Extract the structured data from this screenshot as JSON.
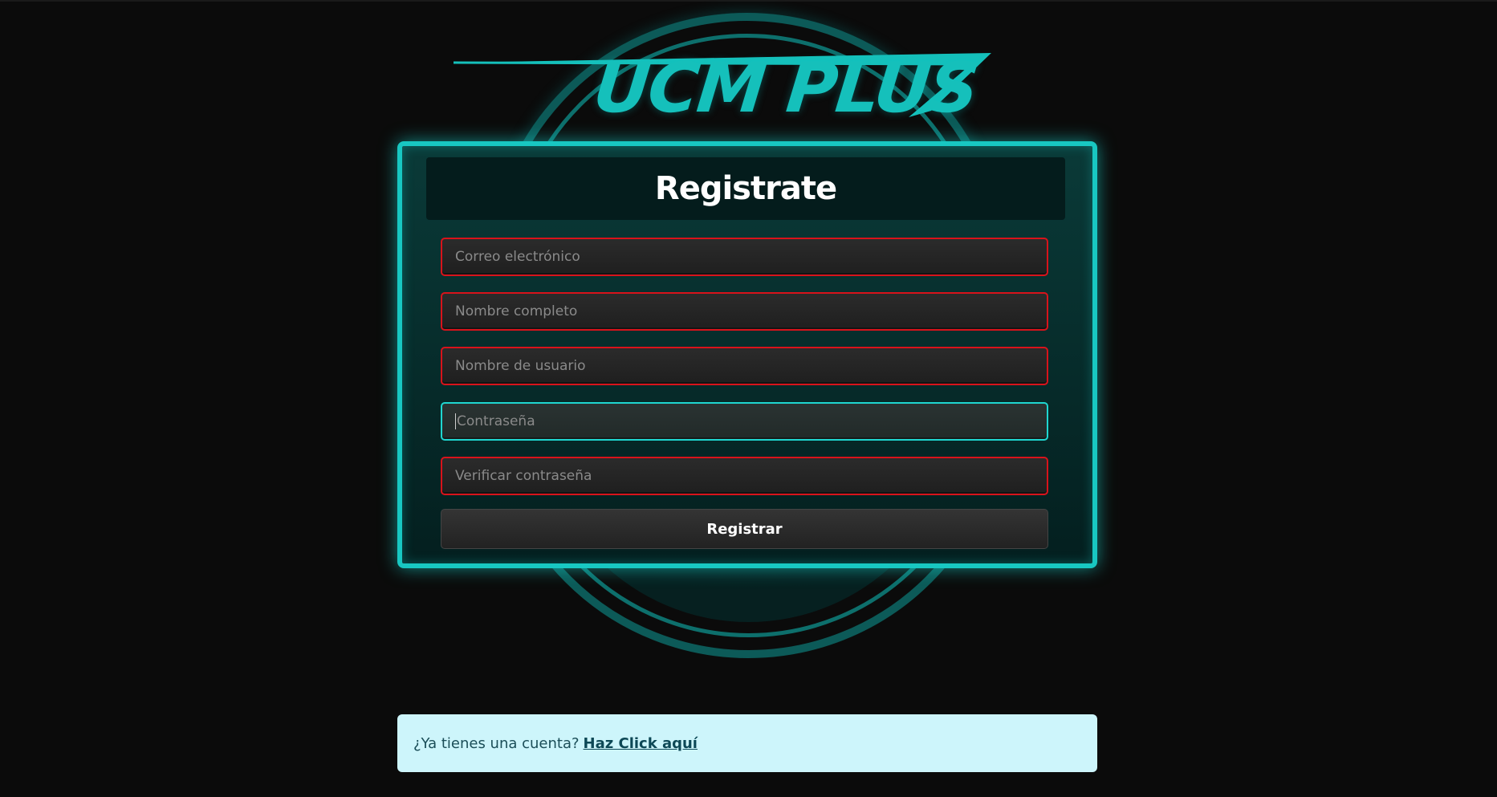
{
  "logo": {
    "text": "UCM PLUS"
  },
  "form": {
    "title": "Registrate",
    "fields": [
      {
        "placeholder": "Correo electrónico",
        "state": "invalid"
      },
      {
        "placeholder": "Nombre completo",
        "state": "invalid"
      },
      {
        "placeholder": "Nombre de usuario",
        "state": "invalid"
      },
      {
        "placeholder": "Contraseña",
        "state": "focused"
      },
      {
        "placeholder": "Verificar contraseña",
        "state": "invalid"
      }
    ],
    "submit_label": "Registrar"
  },
  "login_prompt": {
    "text": "¿Ya tienes una cuenta?",
    "link_label": "Haz Click aquí"
  },
  "colors": {
    "accent": "#18c7c2",
    "invalid_border": "#d8131b",
    "alert_bg": "#cdf5fb"
  }
}
